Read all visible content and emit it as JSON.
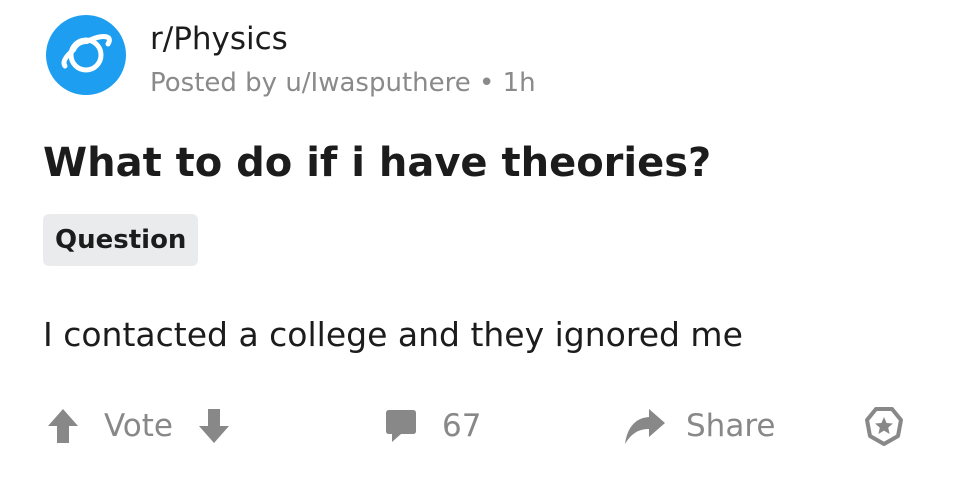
{
  "post": {
    "subreddit": "r/Physics",
    "meta": "Posted by u/Iwasputhere • 1h",
    "title": "What to do if i have theories?",
    "flair": "Question",
    "body": "I contacted a college and they ignored me"
  },
  "actions": {
    "vote_label": "Vote",
    "comments_count": "67",
    "share_label": "Share"
  },
  "icons": {
    "avatar": "planet-icon",
    "upvote": "arrow-up-icon",
    "downvote": "arrow-down-icon",
    "comment": "comment-bubble-icon",
    "share": "share-arrow-icon",
    "award": "award-icon"
  },
  "colors": {
    "avatar_bg": "#1e9ef0",
    "action_gray": "#888888",
    "flair_bg": "#e9ebed"
  }
}
